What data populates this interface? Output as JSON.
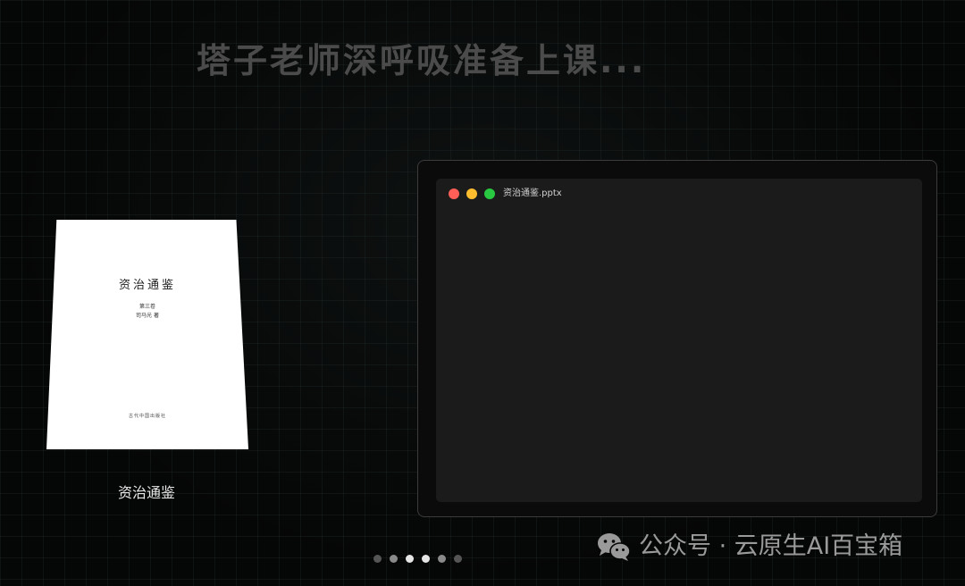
{
  "headline": "塔子老师深呼吸准备上课...",
  "book": {
    "cover": {
      "title": "资治通鉴",
      "volume": "第三卷",
      "author": "司马光 著",
      "publisher": "古代中国出版社"
    },
    "caption": "资治通鉴"
  },
  "window": {
    "title": "资治通鉴.pptx",
    "traffic_lights": {
      "close_color": "#ff5f57",
      "minimize_color": "#febc2e",
      "maximize_color": "#28c840"
    }
  },
  "pagination": {
    "count": 6,
    "dot_colors": [
      "#555555",
      "#8a8a8a",
      "#e6e6e6",
      "#e6e6e6",
      "#8a8a8a",
      "#555555"
    ]
  },
  "watermark": {
    "icon": "wechat-icon",
    "text": "公众号 · 云原生AI百宝箱"
  }
}
